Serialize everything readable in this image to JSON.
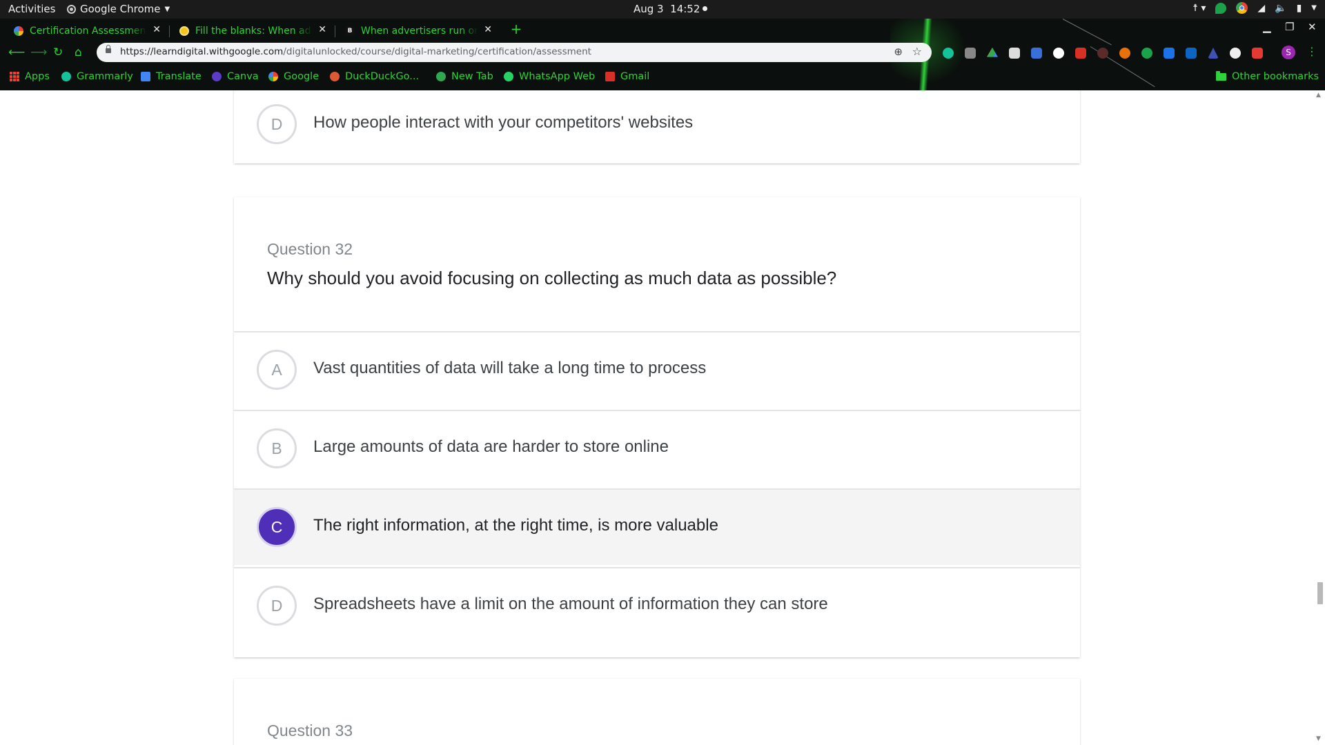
{
  "system_bar": {
    "activities": "Activities",
    "app_name": "Google Chrome",
    "date": "Aug 3",
    "time": "14:52"
  },
  "browser": {
    "tabs": [
      {
        "title": "Certification Assessment",
        "active": true,
        "favicon": "google-icon"
      },
      {
        "title": "Fill the blanks: When adv",
        "active": false,
        "favicon": "yellow-circle-icon"
      },
      {
        "title": "When advertisers run onl",
        "active": false,
        "favicon": "b-icon"
      }
    ],
    "url_host": "https://learndigital.withgoogle.com",
    "url_path": "/digitalunlocked/course/digital-marketing/certification/assessment",
    "profile_initial": "S",
    "bookmarks": [
      {
        "label": "Apps",
        "icon": "apps-grid-icon"
      },
      {
        "label": "Grammarly",
        "icon": "grammarly-icon"
      },
      {
        "label": "Translate",
        "icon": "translate-icon"
      },
      {
        "label": "Canva",
        "icon": "canva-icon"
      },
      {
        "label": "Google",
        "icon": "google-icon"
      },
      {
        "label": "DuckDuckGo...",
        "icon": "duckduckgo-icon"
      },
      {
        "label": "New Tab",
        "icon": "globe-icon"
      },
      {
        "label": "WhatsApp Web",
        "icon": "whatsapp-icon"
      },
      {
        "label": "Gmail",
        "icon": "gmail-icon"
      }
    ],
    "other_bookmarks": "Other bookmarks",
    "accent_color": "#2fd23a"
  },
  "assessment": {
    "previous_question_tail": {
      "option_letter": "D",
      "option_text": "How people interact with your competitors' websites"
    },
    "question": {
      "label": "Question 32",
      "text": "Why should you avoid focusing on collecting as much data as possible?",
      "options": [
        {
          "letter": "A",
          "text": "Vast quantities of data will take a long time to process",
          "selected": false
        },
        {
          "letter": "B",
          "text": "Large amounts of data are harder to store online",
          "selected": false
        },
        {
          "letter": "C",
          "text": "The right information, at the right time, is more valuable",
          "selected": true
        },
        {
          "letter": "D",
          "text": "Spreadsheets have a limit on the amount of information they can store",
          "selected": false
        }
      ],
      "selected_color": "#4f2fb8"
    },
    "next_question": {
      "label": "Question 33"
    }
  }
}
